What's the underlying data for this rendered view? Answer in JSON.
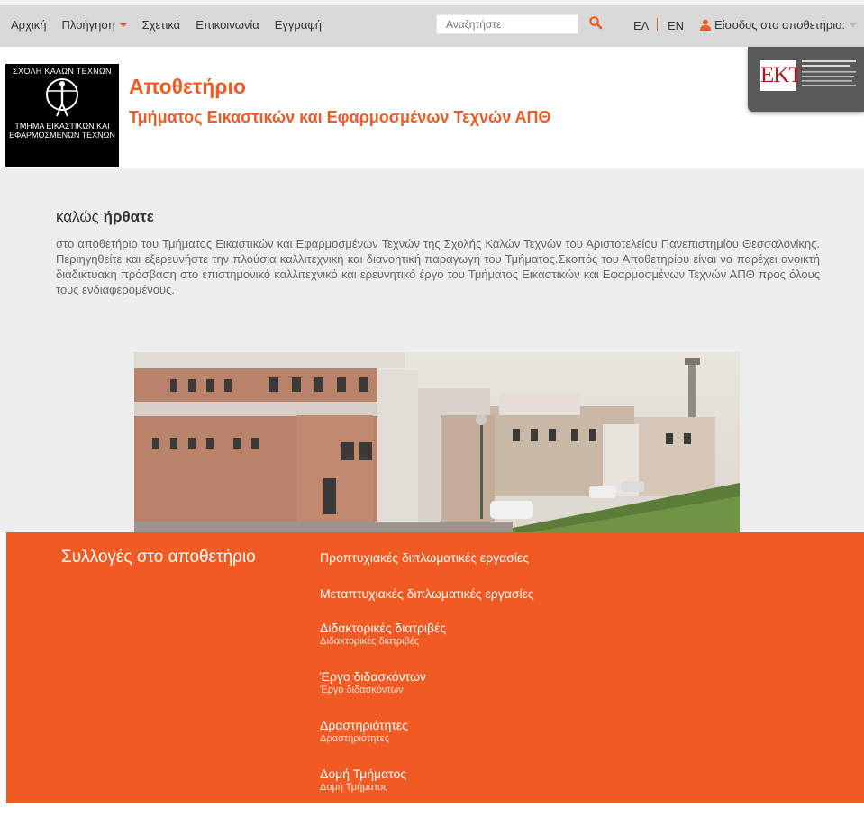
{
  "nav": {
    "items": [
      {
        "label": "Αρχική"
      },
      {
        "label": "Πλοήγηση"
      },
      {
        "label": "Σχετικά"
      },
      {
        "label": "Επικοινωνία"
      },
      {
        "label": "Εγγραφή"
      }
    ],
    "search_placeholder": "Αναζητήστε",
    "lang_el": "ΕΛ",
    "lang_en": "EN",
    "login_label": "Είσοδος στο αποθετήριο:",
    "icons": {
      "search": "search-icon",
      "user": "user-icon",
      "caret": "chevron-down-icon"
    }
  },
  "header": {
    "logo_line1": "ΣΧΟΛΗ ΚΑΛΩΝ ΤΕΧΝΩΝ",
    "logo_line2": "ΤΜΗΜΑ ΕΙΚΑΣΤΙΚΩΝ ΚΑΙ",
    "logo_line3": "ΕΦΑΡΜΟΣΜΕΝΩΝ ΤΕΧΝΩΝ",
    "title": "Αποθετήριο",
    "subtitle": "Τμήματος Εικαστικών και Εφαρμοσμένων Τεχνών ΑΠΘ",
    "ekt_mark": "EKT"
  },
  "welcome": {
    "title_light": "καλώς ",
    "title_bold": "ήρθατε",
    "text": "στο αποθετήριο του Τμήματος Εικαστικών και Εφαρμοσμένων Τεχνών της Σχολής Καλών Τεχνών του Αριστοτελείου Πανεπιστημίου Θεσσαλονίκης. Περιηγηθείτε και εξερευνήστε την πλούσια καλλιτεχνική και διανοητική παραγωγή του Τμήματος.Σκοπός του Αποθετηρίου είναι να παρέχει ανοικτή διαδικτυακή πρόσβαση στο επιστημονικό καλλιτεχνικό και ερευνητικό έργο του Τμήματος Εικαστικών και Εφαρμοσμένων Τεχνών ΑΠΘ προς όλους τους ενδιαφερoμένους."
  },
  "collections": {
    "heading": "Συλλογές στο αποθετήριο",
    "items": [
      {
        "label": "Προπτυχιακές διπλωματικές εργασίες",
        "sub": ""
      },
      {
        "label": "Μεταπτυχιακές διπλωματικές εργασίες",
        "sub": ""
      },
      {
        "label": "Διδακτορικές διατριβές",
        "sub": "Διδακτορικές διατριβές"
      },
      {
        "label": "Έργο διδασκόντων",
        "sub": "Έργο διδασκόντων"
      },
      {
        "label": "Δραστηριότητες",
        "sub": "Δραστηριότητες"
      },
      {
        "label": "Δομή Τμήματος",
        "sub": "Δομή Τμήματος"
      }
    ]
  },
  "colors": {
    "accent": "#f15a22",
    "navbar": "#d9d9d9",
    "welcome_bg": "#eeeeef"
  }
}
